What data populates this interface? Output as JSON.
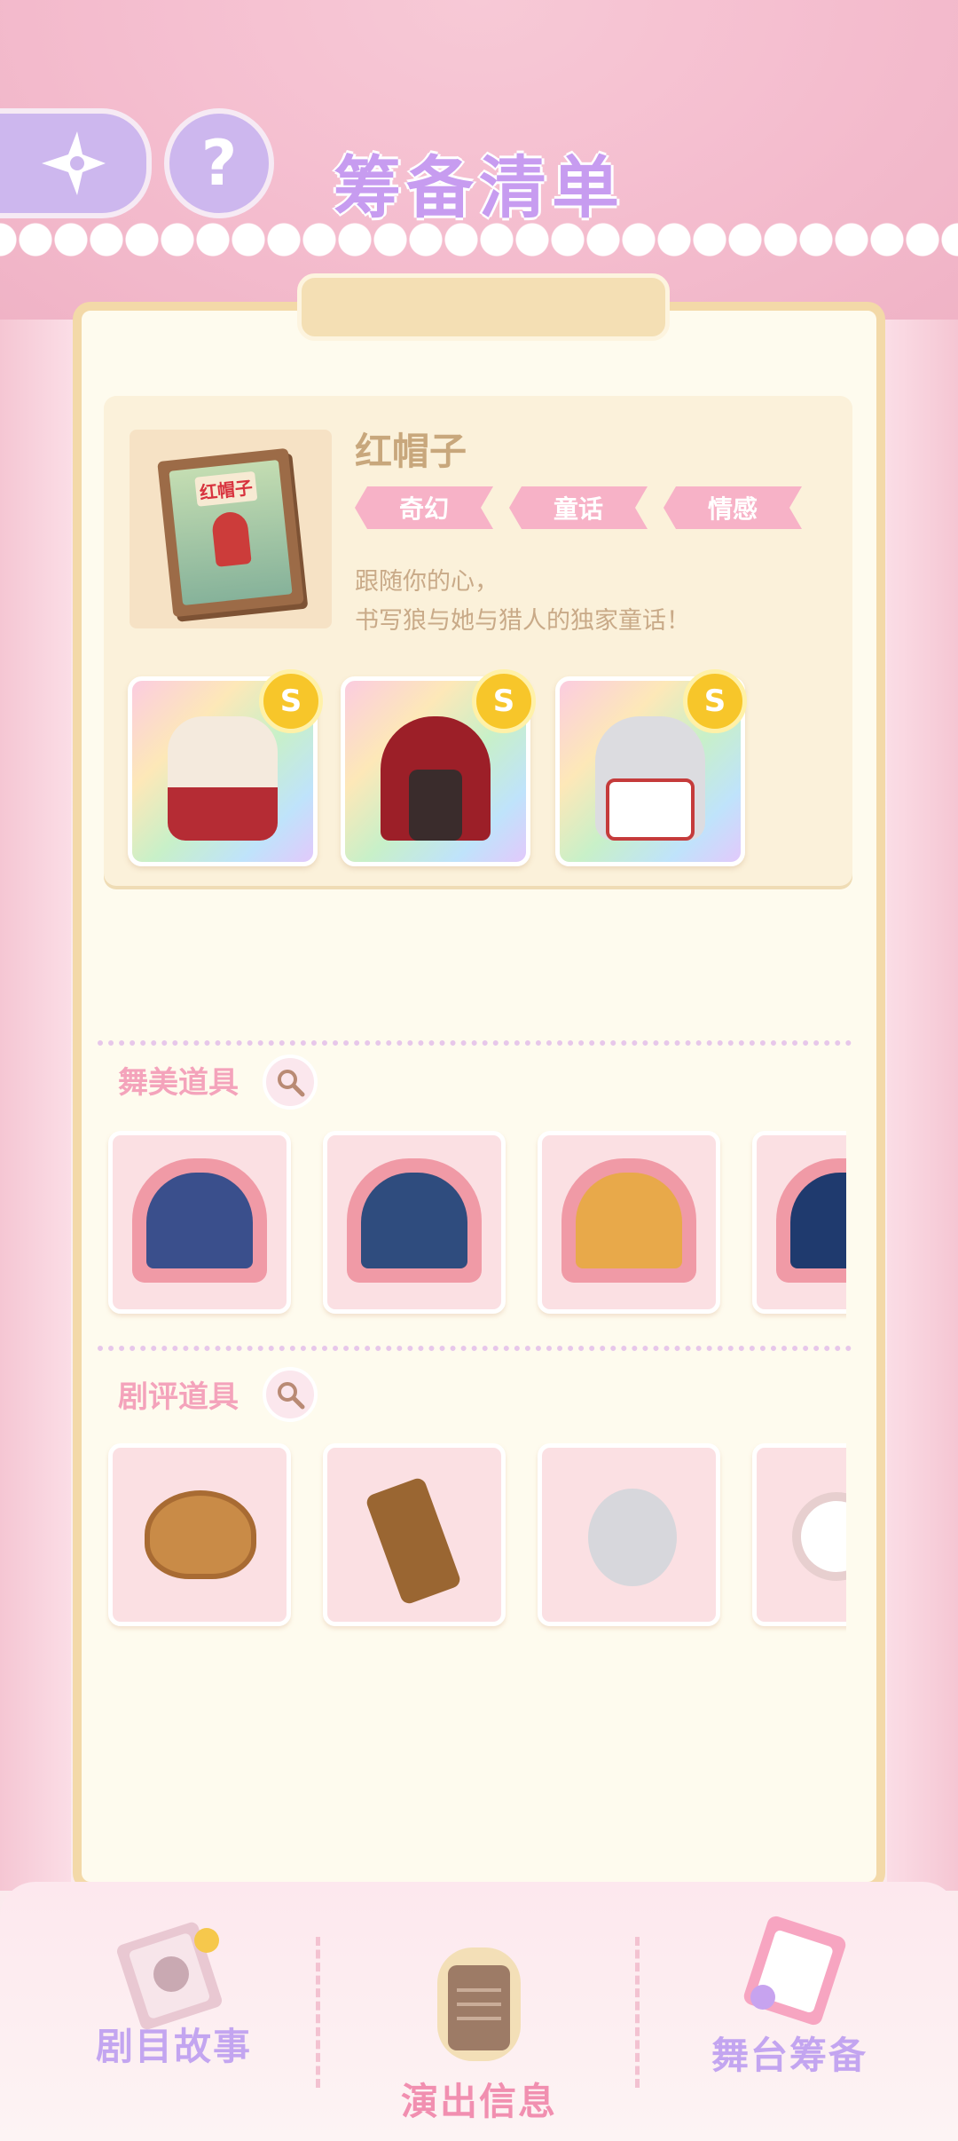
{
  "header": {
    "title": "筹备清单",
    "help_glyph": "?",
    "back_icon": "sparkle-back-icon"
  },
  "story": {
    "name": "红帽子",
    "cover_title": "红帽子",
    "tags": [
      "奇幻",
      "童话",
      "情感"
    ],
    "description_lines": [
      "跟随你的心，",
      "书写狼与她与猎人的独家童话！"
    ],
    "outfits": [
      {
        "badge": "S",
        "color": "#b52c34"
      },
      {
        "badge": "S",
        "color": "#9c1f28"
      },
      {
        "badge": "S",
        "color": "#dcdce0"
      }
    ]
  },
  "sections": {
    "stage_props": {
      "title": "舞美道具",
      "items": [
        {
          "theme": "#3a4f8c"
        },
        {
          "theme": "#2f4c7e"
        },
        {
          "theme": "#e8a94a"
        },
        {
          "theme": "#1f3a6e"
        }
      ]
    },
    "review_props": {
      "title": "剧评道具",
      "items": [
        {
          "name": "basket"
        },
        {
          "name": "quiver"
        },
        {
          "name": "paw"
        },
        {
          "name": "add"
        }
      ]
    }
  },
  "nav": {
    "story": "剧目故事",
    "info": "演出信息",
    "prep": "舞台筹备"
  },
  "colors": {
    "accent_purple": "#c79cf0",
    "tag_pink": "#f7b2c7",
    "section_pink": "#f4a3bb",
    "nav_active": "#f18fb0"
  }
}
